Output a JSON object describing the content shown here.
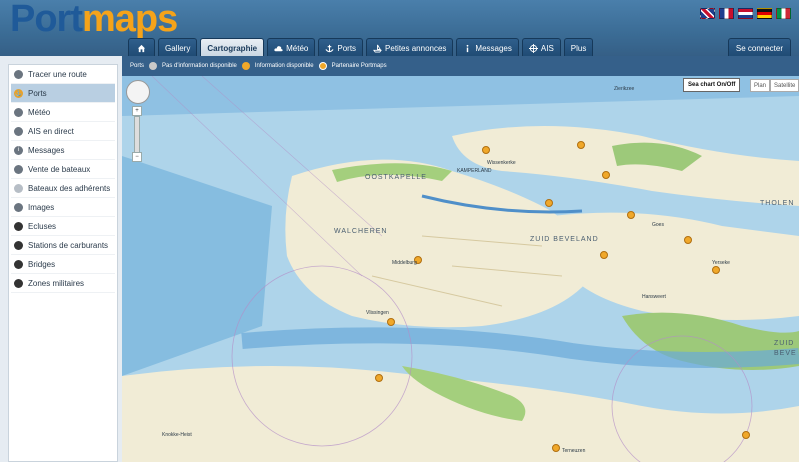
{
  "brand": {
    "part1": "Port",
    "part2": "maps"
  },
  "flags": [
    {
      "name": "uk-flag",
      "c1": "#1f3f8f",
      "c2": "#c8102e",
      "c3": "#ffffff"
    },
    {
      "name": "fr-flag",
      "c1": "#1f3f8f",
      "c2": "#ffffff",
      "c3": "#c8102e"
    },
    {
      "name": "nl-flag",
      "c1": "#c8102e",
      "c2": "#ffffff",
      "c3": "#1f3f8f"
    },
    {
      "name": "de-flag",
      "c1": "#111111",
      "c2": "#dd0000",
      "c3": "#ffce00"
    },
    {
      "name": "it-flag",
      "c1": "#009246",
      "c2": "#ffffff",
      "c3": "#ce2b37"
    }
  ],
  "nav": {
    "home_icon": "home-icon",
    "tabs": [
      {
        "label": "Gallery",
        "icon": ""
      },
      {
        "label": "Cartographie",
        "icon": "",
        "active": true
      },
      {
        "label": "Météo",
        "icon": "cloud-icon"
      },
      {
        "label": "Ports",
        "icon": "anchor-icon"
      },
      {
        "label": "Petites annonces",
        "icon": "boat-icon"
      },
      {
        "label": "Messages",
        "icon": "info-icon"
      },
      {
        "label": "AIS",
        "icon": "compass-icon"
      },
      {
        "label": "Plus",
        "icon": ""
      }
    ],
    "login": "Se connecter"
  },
  "subbar": {
    "title": "Ports",
    "legend": [
      {
        "label": "Pas d'information disponible",
        "color": "#c9c9c9"
      },
      {
        "label": "Information disponible",
        "color": "#f0a82a"
      },
      {
        "label": "Partenaire Portmaps",
        "color": "#f0a82a"
      }
    ]
  },
  "sidebar": {
    "items": [
      {
        "label": "Tracer une route",
        "icon": "route-icon"
      },
      {
        "label": "Ports",
        "icon": "anchor-icon",
        "active": true
      },
      {
        "label": "Météo",
        "icon": "weather-icon"
      },
      {
        "label": "AIS en direct",
        "icon": "ais-icon"
      },
      {
        "label": "Messages",
        "icon": "info-icon"
      },
      {
        "label": "Vente de bateaux",
        "icon": "boat-icon"
      },
      {
        "label": "Bateaux des adhérents",
        "icon": "member-icon"
      },
      {
        "label": "Images",
        "icon": "image-icon"
      },
      {
        "label": "Ecluses",
        "icon": "lock-icon"
      },
      {
        "label": "Stations de carburants",
        "icon": "fuel-icon"
      },
      {
        "label": "Bridges",
        "icon": "bridge-icon"
      },
      {
        "label": "Zones militaires",
        "icon": "military-icon"
      }
    ]
  },
  "map": {
    "sea_chart_button": "Sea chart On/Off",
    "map_types": [
      "Plan",
      "Satellite"
    ],
    "zoom_in": "+",
    "zoom_out": "−",
    "labels": {
      "oostkapelle": "OOSTKAPELLE",
      "walcheren": "WALCHEREN",
      "middelburg": "Middelburg",
      "vlissingen": "Vlissingen",
      "tholen": "THOLEN",
      "zuid_beveland": "ZUID BEVELAND",
      "knokke": "Knokke-Heist",
      "kamperland": "KAMPERLAND",
      "zierikzee": "Zierikzee",
      "wissenkerke": "Wissenkerke",
      "goes": "Goes",
      "terneuzen": "Terneuzen",
      "yerseke": "Yerseke",
      "hansweert": "Hansweert",
      "zuid": "ZUID",
      "bev": "BEVE"
    }
  }
}
